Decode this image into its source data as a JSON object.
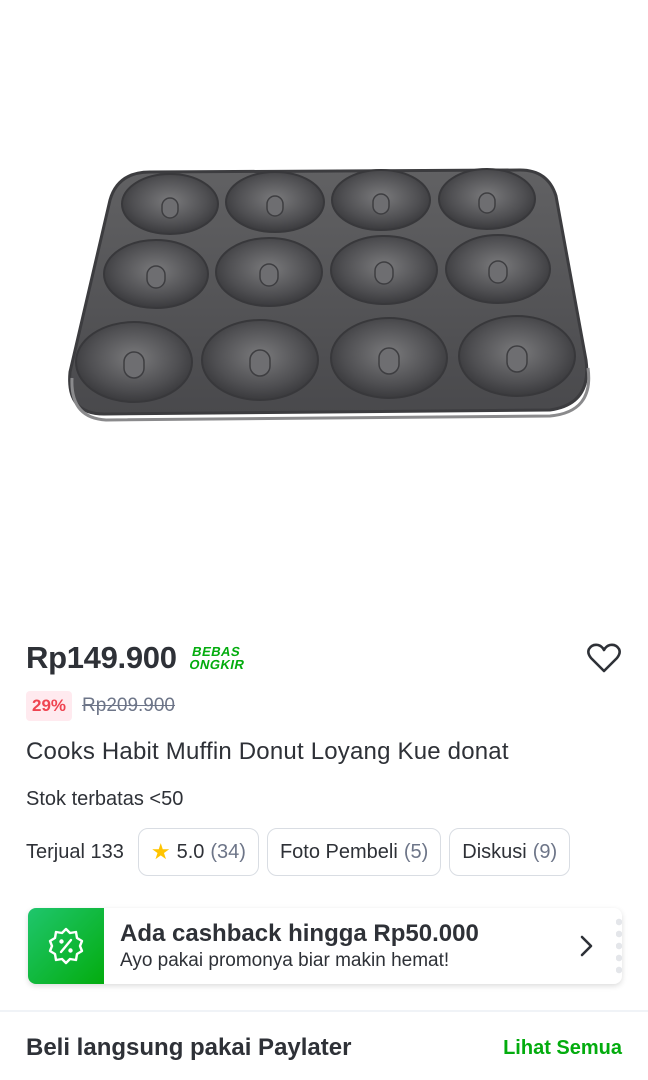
{
  "product": {
    "image_alt": "12-cavity donut baking pan",
    "price": "Rp149.900",
    "free_shipping_line1": "BEBAS",
    "free_shipping_line2": "ONGKIR",
    "discount": "29%",
    "original_price": "Rp209.900",
    "title": "Cooks Habit Muffin Donut Loyang Kue donat",
    "stock": "Stok terbatas <50"
  },
  "stats": {
    "sold": "Terjual 133",
    "rating": "5.0",
    "rating_count": "(34)",
    "photos_label": "Foto Pembeli",
    "photos_count": "(5)",
    "discussion_label": "Diskusi",
    "discussion_count": "(9)"
  },
  "cashback": {
    "title": "Ada cashback hingga Rp50.000",
    "subtitle": "Ayo pakai promonya biar makin hemat!"
  },
  "paylater": {
    "title": "Beli langsung pakai Paylater",
    "see_all": "Lihat Semua"
  },
  "icons": {
    "wishlist": "heart-icon",
    "rating": "star-icon",
    "cashback": "discount-badge-icon",
    "chevron": "chevron-right-icon"
  },
  "colors": {
    "accent_green": "#03ac0e",
    "discount_red": "#ef4451",
    "discount_bg": "#ffeaef",
    "star": "#ffc400"
  }
}
